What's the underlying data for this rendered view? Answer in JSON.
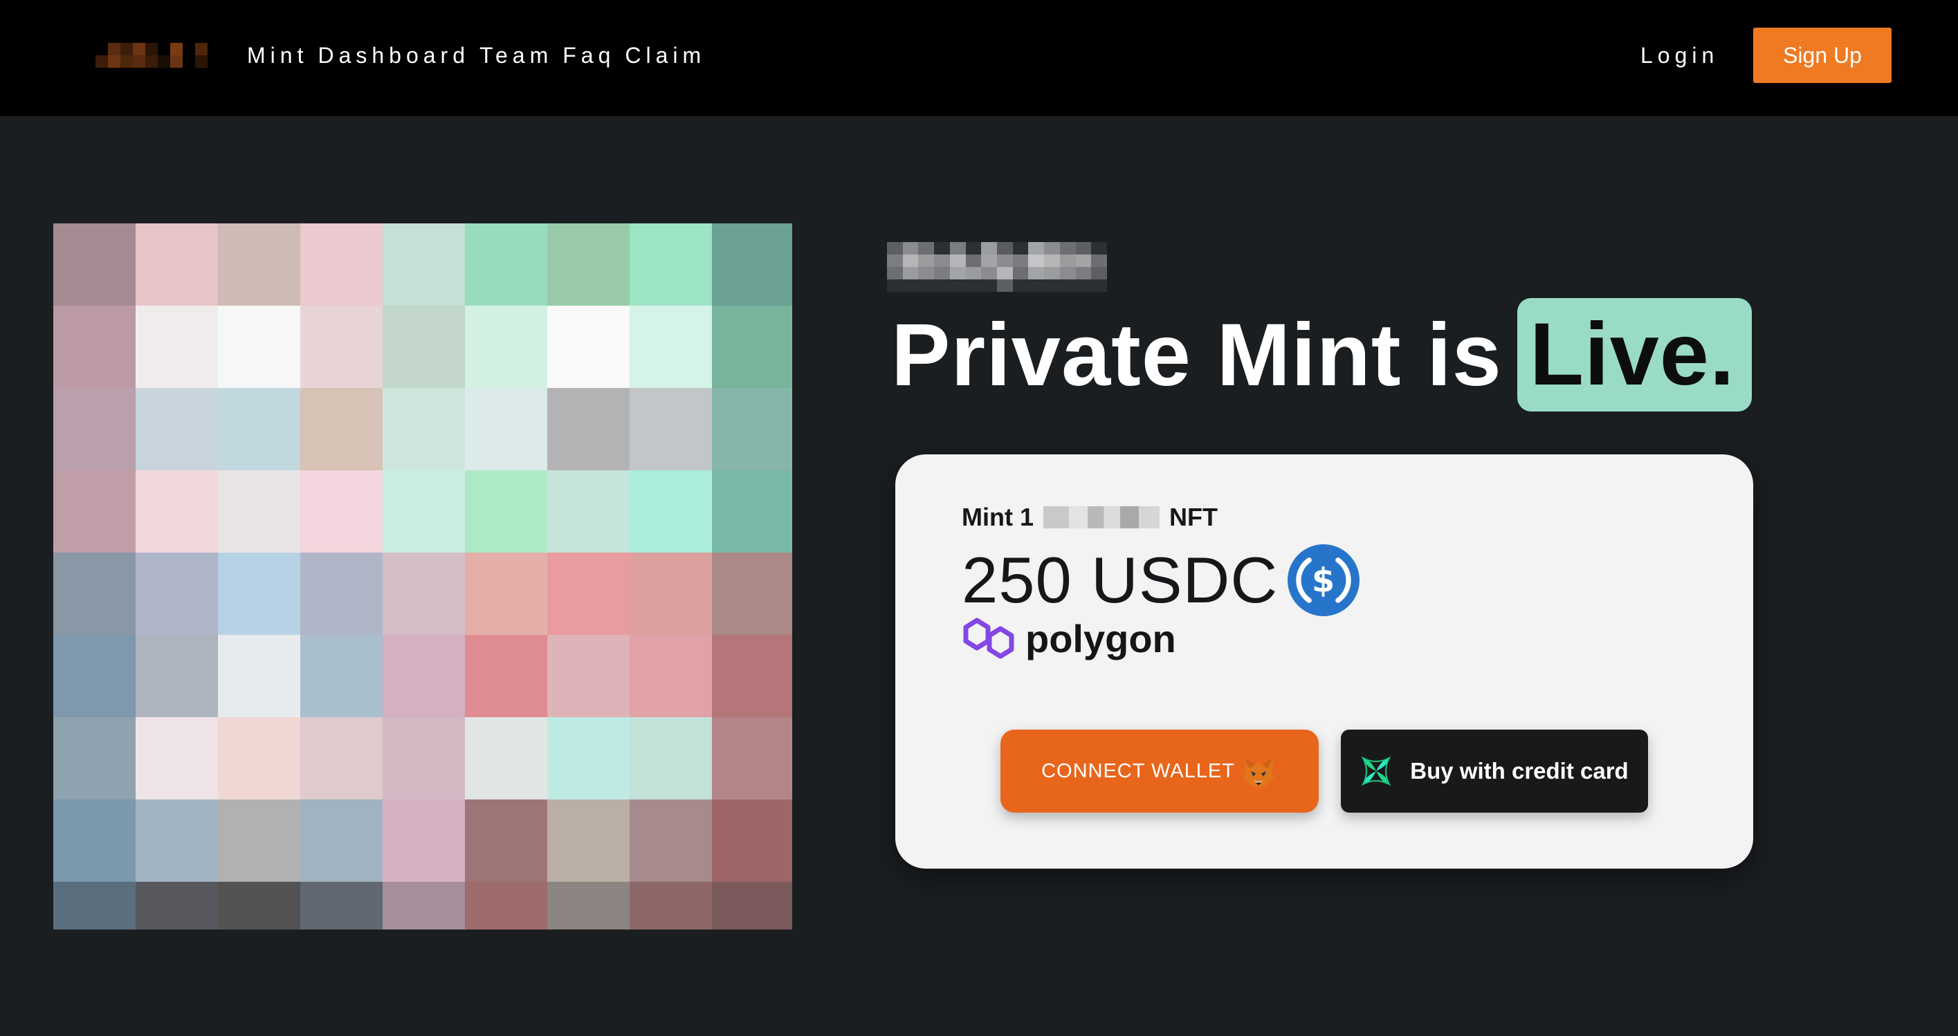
{
  "header": {
    "nav": [
      "Mint",
      "Dashboard",
      "Team",
      "Faq",
      "Claim"
    ],
    "login_label": "Login",
    "signup_label": "Sign Up"
  },
  "hero": {
    "headline": "Private Mint is",
    "headline_highlight": "Live."
  },
  "mint_card": {
    "mint_prefix": "Mint 1",
    "mint_suffix": "NFT",
    "price": "250 USDC",
    "network": "polygon",
    "connect_label": "CONNECT WALLET",
    "buy_label": "Buy with credit card"
  },
  "colors": {
    "accent_orange": "#f07a22",
    "connect_orange": "#e8661c",
    "highlight_mint": "#9adbc5",
    "page_bg": "#1b1e21",
    "card_bg": "#f2f3f2"
  },
  "icons": [
    "usdc-coin-icon",
    "polygon-logo-icon",
    "metamask-fox-icon",
    "crossmint-icon"
  ]
}
